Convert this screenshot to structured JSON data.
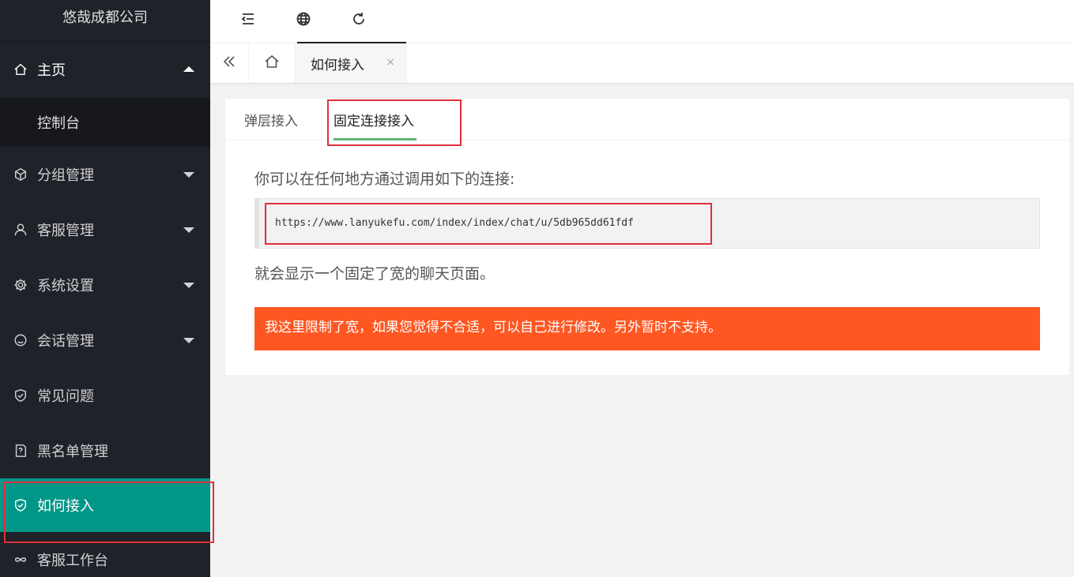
{
  "sidebar": {
    "logo": "悠哉成都公司",
    "items": [
      {
        "label": "主页",
        "icon": "home-icon"
      },
      {
        "label": "控制台"
      },
      {
        "label": "分组管理",
        "icon": "cube-icon"
      },
      {
        "label": "客服管理",
        "icon": "user-icon"
      },
      {
        "label": "系统设置",
        "icon": "gear-icon"
      },
      {
        "label": "会话管理",
        "icon": "smile-icon"
      },
      {
        "label": "常见问题",
        "icon": "shield-icon"
      },
      {
        "label": "黑名单管理",
        "icon": "help-doc-icon"
      },
      {
        "label": "如何接入",
        "icon": "shield-icon"
      },
      {
        "label": "客服工作台",
        "icon": "link-icon"
      }
    ],
    "active_color": "#009688"
  },
  "header": {
    "icons": [
      "menu-fold-icon",
      "globe-icon",
      "refresh-icon"
    ]
  },
  "tabsbar": {
    "current_tab": "如何接入",
    "close_glyph": "×"
  },
  "content": {
    "tabs": [
      "弹层接入",
      "固定连接接入"
    ],
    "intro": "你可以在任何地方通过调用如下的连接:",
    "url": "https://www.lanyukefu.com/index/index/chat/u/5db965dd61fdf",
    "note": "就会显示一个固定了宽的聊天页面。",
    "warning": "我这里限制了宽，如果您觉得不合适，可以自己进行修改。另外暂时不支持。",
    "warning_color": "#ff5722"
  }
}
